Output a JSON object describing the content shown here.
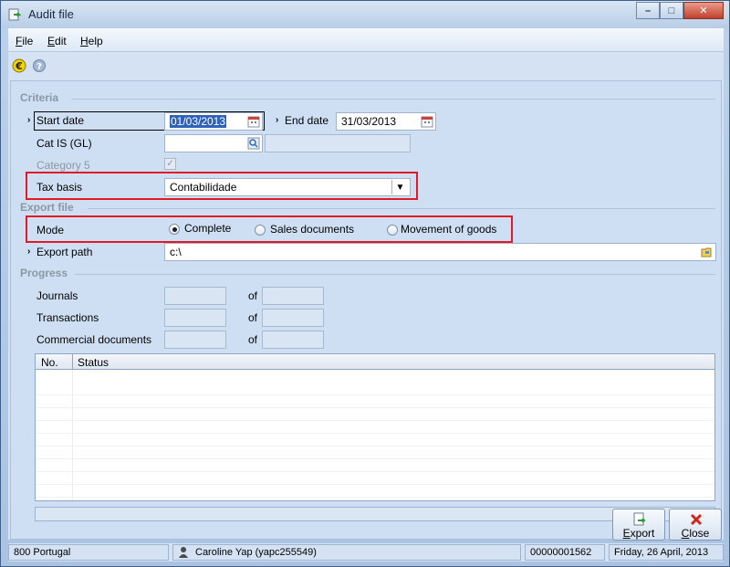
{
  "window": {
    "title": "Audit file",
    "minimize": "–",
    "maximize": "□",
    "close": "✕"
  },
  "menu": {
    "file_u": "F",
    "file_rest": "ile",
    "edit_u": "E",
    "edit_rest": "dit",
    "help_u": "H",
    "help_rest": "elp"
  },
  "toolbar": {
    "icons": [
      "euro-icon",
      "help-icon"
    ]
  },
  "criteria": {
    "section_title": "Criteria",
    "start_date_label": "Start date",
    "start_date_value": "01/03/2013",
    "end_date_label": "End date",
    "end_date_value": "31/03/2013",
    "cat_is_label": "Cat IS (GL)",
    "cat_is_value": "",
    "cat_is_description": "",
    "category5_label": "Category 5",
    "category5_checked": true,
    "tax_basis_label": "Tax basis",
    "tax_basis_value": "Contabilidade"
  },
  "export_file": {
    "section_title": "Export file",
    "mode_label": "Mode",
    "mode_options": [
      "Complete",
      "Sales documents",
      "Movement of goods"
    ],
    "mode_selected": "Complete",
    "export_path_label": "Export path",
    "export_path_value": "c:\\"
  },
  "progress": {
    "section_title": "Progress",
    "of_label": "of",
    "rows": [
      {
        "label": "Journals",
        "current": "",
        "total": ""
      },
      {
        "label": "Transactions",
        "current": "",
        "total": ""
      },
      {
        "label": "Commercial documents",
        "current": "",
        "total": ""
      }
    ]
  },
  "grid": {
    "columns": [
      "No.",
      "Status"
    ],
    "rows": []
  },
  "buttons": {
    "export_u": "E",
    "export_rest": "xport",
    "close_u": "C",
    "close_rest": "lose"
  },
  "statusbar": {
    "company": "800 Portugal",
    "user": "Caroline Yap (yapc255549)",
    "counter": "00000001562",
    "date": "Friday, 26 April, 2013"
  },
  "colors": {
    "highlight_box": "#e21a26",
    "selection": "#3062b7"
  }
}
